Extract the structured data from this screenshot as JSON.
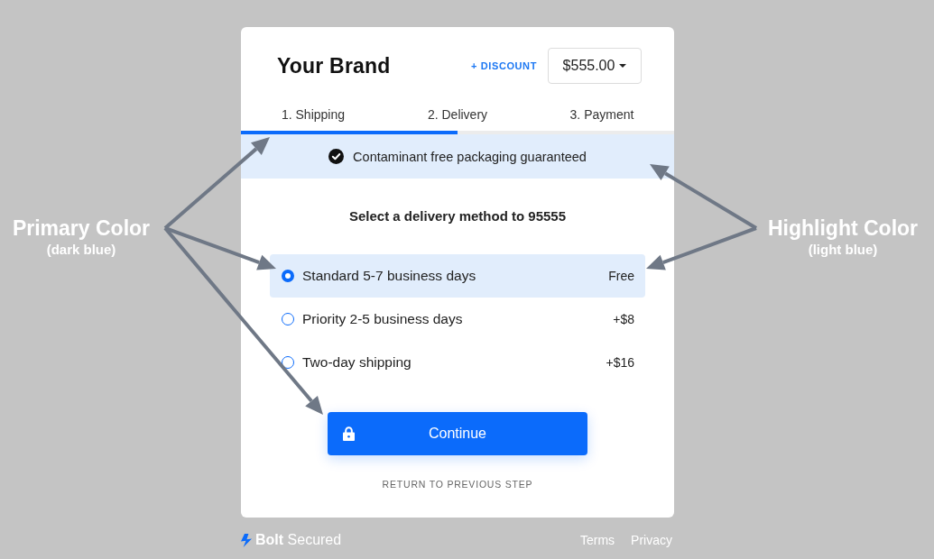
{
  "annotations": [
    {
      "title": "Primary Color",
      "subtitle": "(dark blue)"
    },
    {
      "title": "Highlight Color",
      "subtitle": "(light blue)"
    }
  ],
  "header": {
    "brand": "Your Brand",
    "discount_link": "+ DISCOUNT",
    "total": "$555.00"
  },
  "steps": [
    {
      "label": "1. Shipping"
    },
    {
      "label": "2. Delivery"
    },
    {
      "label": "3. Payment"
    }
  ],
  "progress": {
    "level": 0.5
  },
  "banner": {
    "text": "Contaminant free packaging guaranteed"
  },
  "heading": "Select a delivery method to 95555",
  "options": [
    {
      "label": "Standard 5-7 business days",
      "price": "Free",
      "selected": true
    },
    {
      "label": "Priority 2-5 business days",
      "price": "+$8",
      "selected": false
    },
    {
      "label": "Two-day shipping",
      "price": "+$16",
      "selected": false
    }
  ],
  "continue_button": "Continue",
  "return_link": "RETURN TO PREVIOUS STEP",
  "footer": {
    "badge": "**Bolt** Secured",
    "links": [
      "Terms",
      "Privacy"
    ]
  }
}
